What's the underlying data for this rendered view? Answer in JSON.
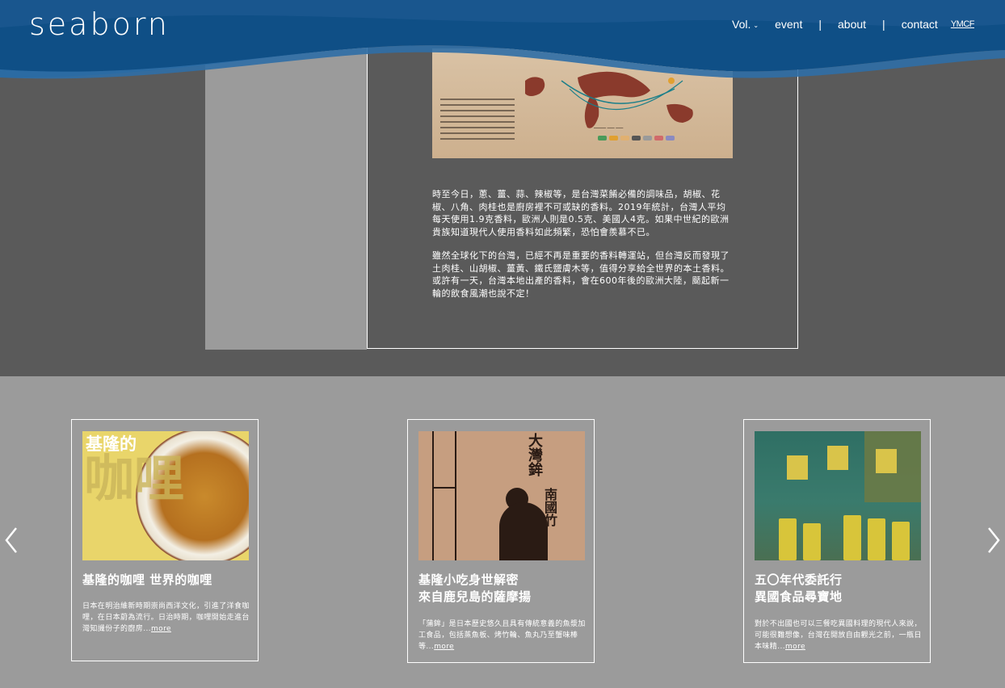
{
  "header": {
    "logo": "seaborn",
    "nav": {
      "vol": "Vol.",
      "event": "event",
      "about": "about",
      "contact": "contact",
      "separator": "|",
      "ymcf": "YMCF"
    }
  },
  "article": {
    "paragraph1": "時至今日，蔥、薑、蒜、辣椒等，是台灣菜餚必備的調味品，胡椒、花椒、八角、肉桂也是廚房裡不可或缺的香料。2019年統計，台灣人平均每天使用1.9克香料，歐洲人則是0.5克、美國人4克。如果中世紀的歐洲貴族知道現代人使用香料如此頻繁，恐怕會羨慕不已。",
    "paragraph2": "雖然全球化下的台灣，已經不再是重要的香料轉運站，但台灣反而發現了土肉桂、山胡椒、薑黃、鐵氏鹽膚木等，值得分享給全世界的本土香料。或許有一天，台灣本地出產的香料，會在600年後的歐洲大陸，颳起新一輪的飲食風潮也說不定！"
  },
  "cards": [
    {
      "image_title": "基隆的",
      "image_big": "咖哩",
      "title_line1": "基隆的咖哩 世界的咖哩",
      "title_line2": "",
      "desc": "日本在明治維新時期崇尚西洋文化，引進了洋食咖哩，在日本蔚為流行。日治時期，咖哩開始走進台灣知識份子的廚房",
      "ellipsis": "...",
      "more": "more"
    },
    {
      "image_title": "大灣鉾",
      "image_big": "南國竹",
      "title_line1": "基隆小吃身世解密",
      "title_line2": "來自鹿兒島的薩摩揚",
      "desc": "「蒲鉾」是日本歷史悠久且具有傳統意義的魚漿加工食品，包括蒸魚板、烤竹輪、魚丸乃至蟹味棒等",
      "ellipsis": "...",
      "more": "more"
    },
    {
      "title_line1": "五〇年代委託行",
      "title_line2": "異國食品尋寶地",
      "desc": "對於不出國也可以三餐吃異國料理的現代人來說，可能很難想像，台灣在開放自由觀光之前，一瓶日本味精",
      "ellipsis": "...",
      "more": "more"
    }
  ],
  "carousel": {
    "prev_icon": "chevron-left-icon",
    "next_icon": "chevron-right-icon"
  },
  "colors": {
    "header_blue": "#0f4f86",
    "wave_light": "#2f6ea6",
    "dark_section": "#5a5a5a",
    "light_section": "#9b9b9b"
  }
}
